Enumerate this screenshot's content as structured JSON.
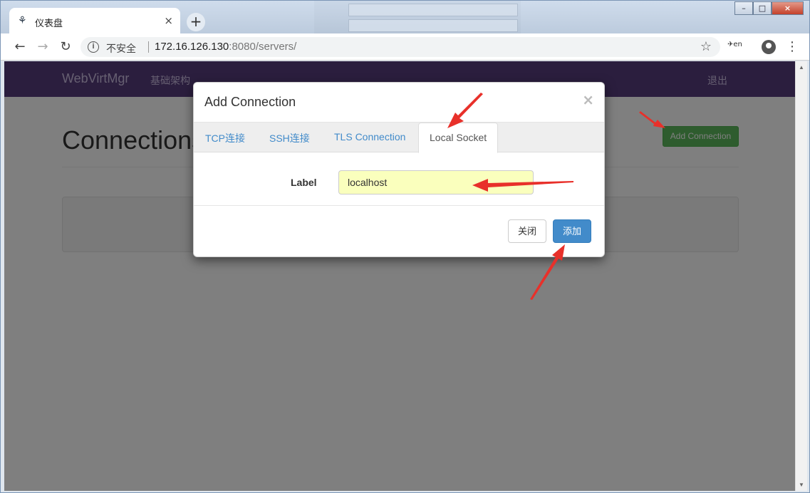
{
  "browser": {
    "tab_title": "仪表盘",
    "tab_favicon": "webvirtmgr-favicon",
    "tab_close": "×",
    "new_tab": "+",
    "security_label": "不安全",
    "url_host": "172.16.126.130",
    "url_rest": ":8080/servers/",
    "back": "←",
    "forward": "→",
    "reload": "↻",
    "star": "☆",
    "menu": "⋮",
    "window_buttons": {
      "minimize": "–",
      "maximize": "□",
      "close": "×"
    }
  },
  "navbar": {
    "brand": "WebVirtMgr",
    "link": "基础架构",
    "logout": "退出"
  },
  "page": {
    "title": "Connections",
    "add_button": "Add Connection"
  },
  "modal": {
    "title": "Add Connection",
    "close": "×",
    "tabs": [
      "TCP连接",
      "SSH连接",
      "TLS Connection",
      "Local Socket"
    ],
    "active_tab": "Local Socket",
    "label_text": "Label",
    "label_value": "localhost",
    "close_button": "关闭",
    "add_button": "添加"
  },
  "colors": {
    "navbar": "#563d7c",
    "success": "#5cb85c",
    "primary": "#428bca",
    "annotation_arrow": "#e8302a",
    "autofill": "#faffbd"
  }
}
